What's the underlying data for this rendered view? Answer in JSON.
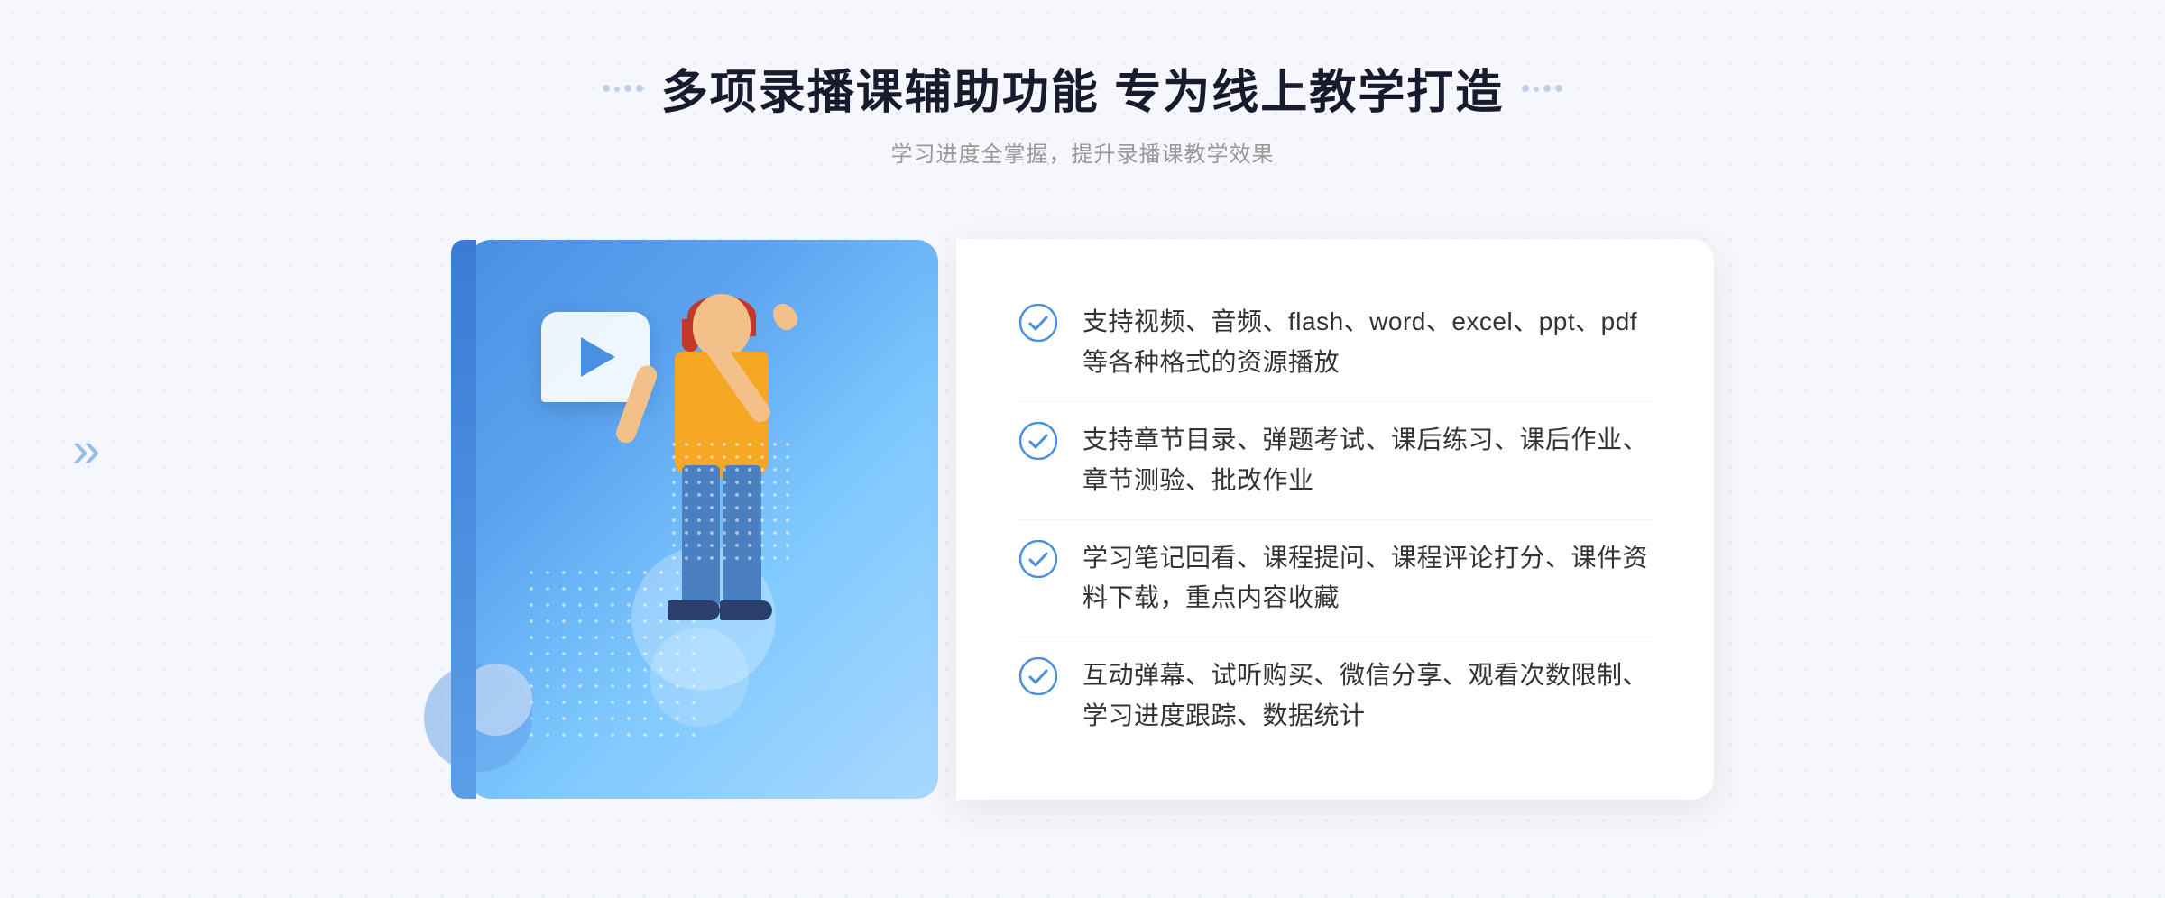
{
  "header": {
    "title": "多项录播课辅助功能 专为线上教学打造",
    "subtitle": "学习进度全掌握，提升录播课教学效果"
  },
  "features": [
    {
      "id": 1,
      "text": "支持视频、音频、flash、word、excel、ppt、pdf等各种格式的资源播放"
    },
    {
      "id": 2,
      "text": "支持章节目录、弹题考试、课后练习、课后作业、章节测验、批改作业"
    },
    {
      "id": 3,
      "text": "学习笔记回看、课程提问、课程评论打分、课件资料下载，重点内容收藏"
    },
    {
      "id": 4,
      "text": "互动弹幕、试听购买、微信分享、观看次数限制、学习进度跟踪、数据统计"
    }
  ],
  "decorative": {
    "chevron_symbol": "»",
    "play_button_aria": "play button",
    "check_icon_color": "#4a90e2"
  }
}
